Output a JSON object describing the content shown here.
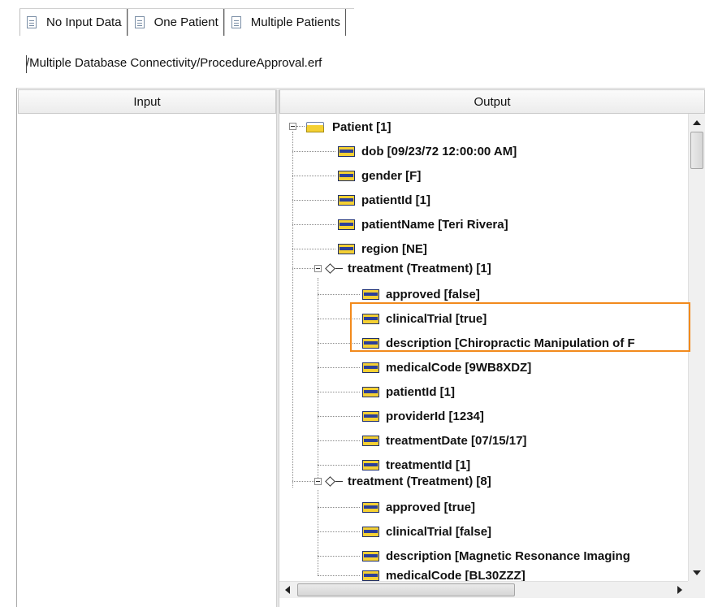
{
  "tabs": [
    {
      "label": "No Input Data",
      "icon": "document-icon",
      "active": true
    },
    {
      "label": "One Patient",
      "icon": "document-icon",
      "active": false
    },
    {
      "label": "Multiple Patients",
      "icon": "document-icon",
      "active": false
    }
  ],
  "path": "/Multiple Database Connectivity/ProcedureApproval.erf",
  "columns": {
    "input": "Input",
    "output": "Output"
  },
  "tree": {
    "root": "Patient [1]",
    "patient_fields": [
      "dob [09/23/72 12:00:00 AM]",
      "gender [F]",
      "patientId [1]",
      "patientName [Teri Rivera]",
      "region [NE]"
    ],
    "treatment1": {
      "label": "treatment (Treatment) [1]",
      "fields": [
        "approved [false]",
        "clinicalTrial [true]",
        "description [Chiropractic Manipulation of F",
        "medicalCode [9WB8XDZ]",
        "patientId [1]",
        "providerId [1234]",
        "treatmentDate [07/15/17]",
        "treatmentId [1]"
      ]
    },
    "treatment2": {
      "label": "treatment (Treatment) [8]",
      "fields": [
        "approved [true]",
        "clinicalTrial [false]",
        "description [Magnetic Resonance Imaging",
        "medicalCode [BL30ZZZ]"
      ]
    }
  },
  "colors": {
    "highlight": "#f28a1c",
    "field_icon": "#2c3f99",
    "entity_icon": "#f4d033"
  }
}
